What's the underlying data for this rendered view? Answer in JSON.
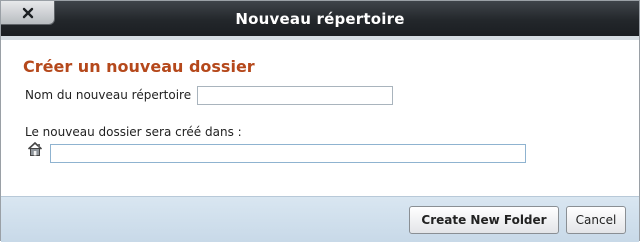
{
  "dialog": {
    "title": "Nouveau répertoire",
    "close_icon": "close-icon"
  },
  "form": {
    "heading": "Créer un nouveau dossier",
    "name_label": "Nom du nouveau répertoire",
    "name_value": "",
    "location_label": "Le nouveau dossier sera créé dans :",
    "location_icon": "home-icon",
    "location_value": ""
  },
  "buttons": {
    "create_label": "Create New Folder",
    "cancel_label": "Cancel"
  },
  "colors": {
    "title_bar": "#2a2e33",
    "heading": "#b5481b",
    "footer": "#d2e1ee"
  }
}
